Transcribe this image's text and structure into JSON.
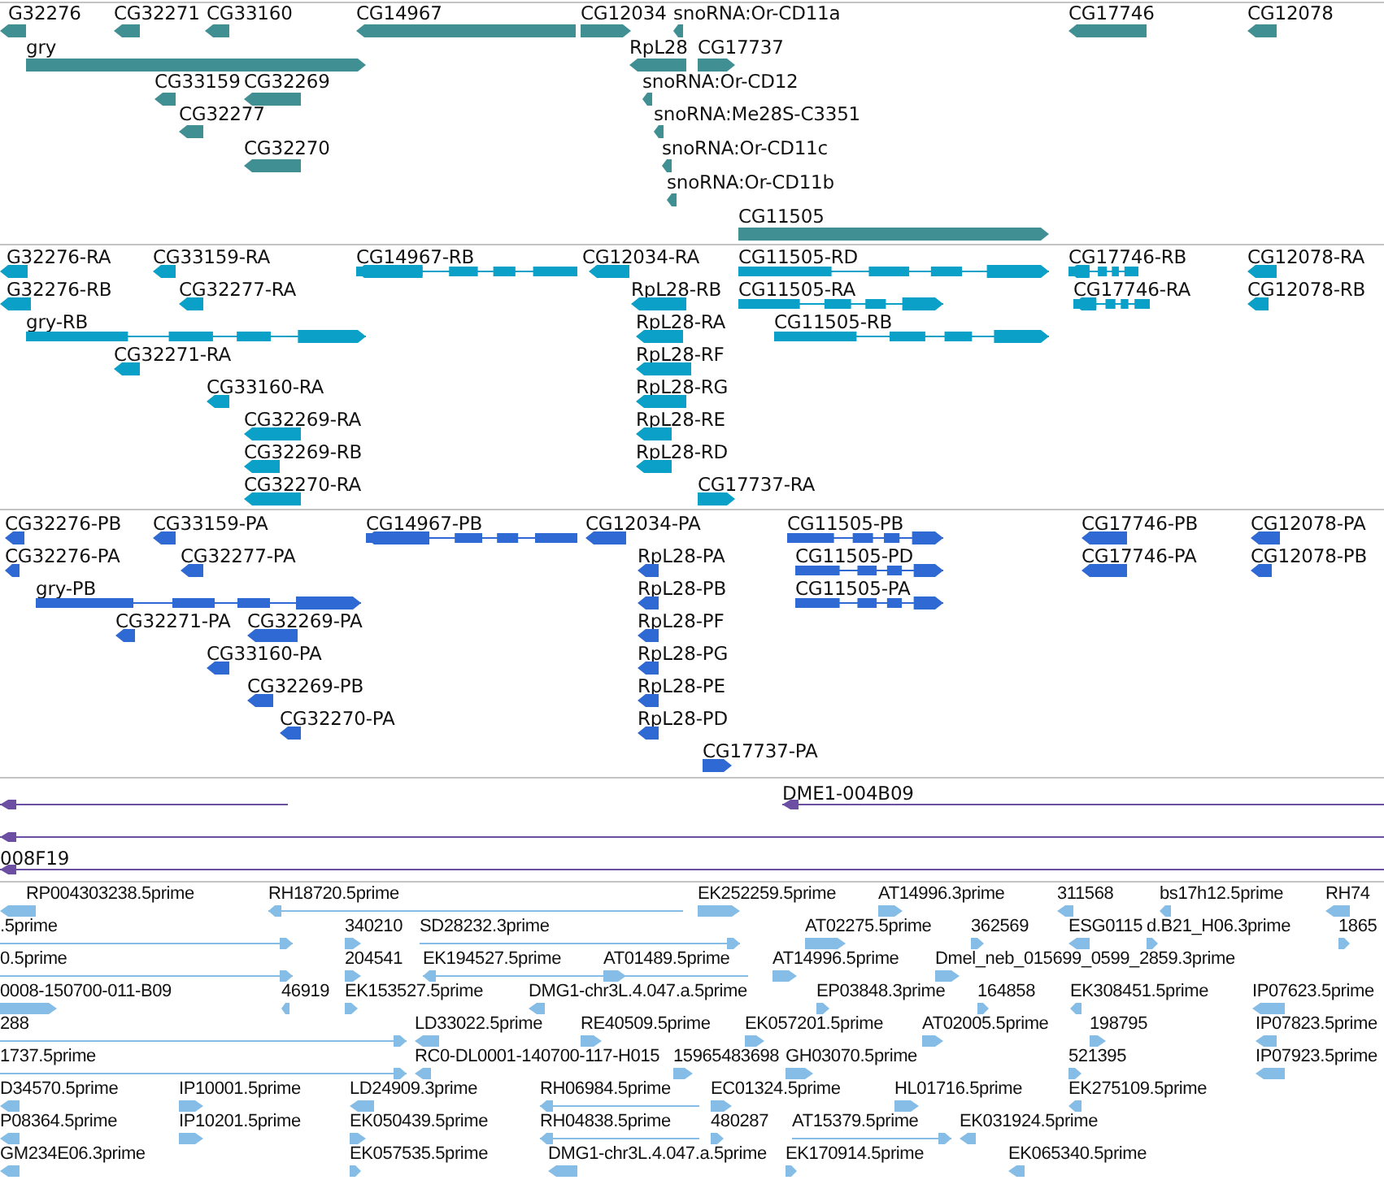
{
  "tracks": [
    {
      "kind": "gene",
      "lanes": [
        {
          "features": [
            {
              "label": "G32276",
              "reverse": true
            },
            {
              "label": "CG32271",
              "reverse": true
            },
            {
              "label": "CG33160",
              "reverse": true
            },
            {
              "label": "CG14967",
              "reverse": true
            },
            {
              "label": "CG12034",
              "reverse": false
            },
            {
              "label": "snoRNA:Or-CD11a",
              "reverse": true
            },
            {
              "label": "CG17746",
              "reverse": true
            },
            {
              "label": "CG12078",
              "reverse": true
            }
          ]
        },
        {
          "features": [
            {
              "label": "gry",
              "reverse": false
            },
            {
              "label": "RpL28",
              "reverse": true
            },
            {
              "label": "CG17737",
              "reverse": false
            }
          ]
        },
        {
          "features": [
            {
              "label": "CG33159",
              "reverse": true
            },
            {
              "label": "CG32269",
              "reverse": true
            },
            {
              "label": "snoRNA:Or-CD12",
              "reverse": true
            }
          ]
        },
        {
          "features": [
            {
              "label": "CG32277",
              "reverse": true
            },
            {
              "label": "snoRNA:Me28S-C3351",
              "reverse": true
            }
          ]
        },
        {
          "features": [
            {
              "label": "CG32270",
              "reverse": true
            },
            {
              "label": "snoRNA:Or-CD11c",
              "reverse": true
            }
          ]
        },
        {
          "features": [
            {
              "label": "snoRNA:Or-CD11b",
              "reverse": true
            }
          ]
        },
        {
          "features": [
            {
              "label": "CG11505",
              "reverse": false
            }
          ]
        }
      ]
    },
    {
      "kind": "mrna",
      "lanes": [
        {
          "features": [
            {
              "label": "G32276-RA",
              "reverse": true
            },
            {
              "label": "CG33159-RA",
              "reverse": true
            },
            {
              "label": "CG14967-RB",
              "reverse": true
            },
            {
              "label": "CG12034-RA",
              "reverse": true
            },
            {
              "label": "CG11505-RD",
              "reverse": false
            },
            {
              "label": "CG17746-RB",
              "reverse": true
            },
            {
              "label": "CG12078-RA",
              "reverse": true
            }
          ]
        },
        {
          "features": [
            {
              "label": "G32276-RB",
              "reverse": true
            },
            {
              "label": "CG32277-RA",
              "reverse": true
            },
            {
              "label": "RpL28-RB",
              "reverse": true
            },
            {
              "label": "CG11505-RA",
              "reverse": false
            },
            {
              "label": "CG17746-RA",
              "reverse": true
            },
            {
              "label": "CG12078-RB",
              "reverse": true
            }
          ]
        },
        {
          "features": [
            {
              "label": "gry-RB",
              "reverse": false
            },
            {
              "label": "RpL28-RA",
              "reverse": true
            },
            {
              "label": "CG11505-RB",
              "reverse": false
            }
          ]
        },
        {
          "features": [
            {
              "label": "CG32271-RA",
              "reverse": true
            },
            {
              "label": "RpL28-RF",
              "reverse": true
            }
          ]
        },
        {
          "features": [
            {
              "label": "CG33160-RA",
              "reverse": true
            },
            {
              "label": "RpL28-RG",
              "reverse": true
            }
          ]
        },
        {
          "features": [
            {
              "label": "CG32269-RA",
              "reverse": true
            },
            {
              "label": "RpL28-RE",
              "reverse": true
            }
          ]
        },
        {
          "features": [
            {
              "label": "CG32269-RB",
              "reverse": true
            },
            {
              "label": "RpL28-RD",
              "reverse": true
            }
          ]
        },
        {
          "features": [
            {
              "label": "CG32270-RA",
              "reverse": true
            },
            {
              "label": "CG17737-RA",
              "reverse": false
            }
          ]
        }
      ]
    },
    {
      "kind": "protein",
      "lanes": [
        {
          "features": [
            {
              "label": "CG32276-PB",
              "reverse": true
            },
            {
              "label": "CG33159-PA",
              "reverse": true
            },
            {
              "label": "CG14967-PB",
              "reverse": true
            },
            {
              "label": "CG12034-PA",
              "reverse": true
            },
            {
              "label": "CG11505-PB",
              "reverse": false
            },
            {
              "label": "CG17746-PB",
              "reverse": true
            },
            {
              "label": "CG12078-PA",
              "reverse": true
            }
          ]
        },
        {
          "features": [
            {
              "label": "CG32276-PA",
              "reverse": true
            },
            {
              "label": "CG32277-PA",
              "reverse": true
            },
            {
              "label": "RpL28-PA",
              "reverse": true
            },
            {
              "label": "CG11505-PD",
              "reverse": false
            },
            {
              "label": "CG17746-PA",
              "reverse": true
            },
            {
              "label": "CG12078-PB",
              "reverse": true
            }
          ]
        },
        {
          "features": [
            {
              "label": "gry-PB",
              "reverse": false
            },
            {
              "label": "RpL28-PB",
              "reverse": true
            },
            {
              "label": "CG11505-PA",
              "reverse": false
            }
          ]
        },
        {
          "features": [
            {
              "label": "CG32271-PA",
              "reverse": true
            },
            {
              "label": "CG32269-PA",
              "reverse": true
            },
            {
              "label": "RpL28-PF",
              "reverse": true
            }
          ]
        },
        {
          "features": [
            {
              "label": "CG33160-PA",
              "reverse": true
            },
            {
              "label": "RpL28-PG",
              "reverse": true
            }
          ]
        },
        {
          "features": [
            {
              "label": "CG32269-PB",
              "reverse": true
            },
            {
              "label": "RpL28-PE",
              "reverse": true
            }
          ]
        },
        {
          "features": [
            {
              "label": "CG32270-PA",
              "reverse": true
            },
            {
              "label": "RpL28-PD",
              "reverse": true
            }
          ]
        },
        {
          "features": [
            {
              "label": "CG17737-PA",
              "reverse": false
            }
          ]
        }
      ]
    },
    {
      "kind": "clone",
      "lanes": [
        {
          "features": [
            {
              "reverse": true
            },
            {
              "label": "DME1-004B09",
              "reverse": true
            }
          ]
        },
        {
          "features": [
            {
              "reverse": true
            }
          ]
        },
        {
          "features": [
            {
              "label": "008F19",
              "reverse": true
            }
          ]
        }
      ]
    },
    {
      "kind": "est",
      "lanes": [
        {
          "features": [
            {
              "label": "RP004303238.5prime",
              "reverse": true
            },
            {
              "label": "RH18720.5prime",
              "reverse": true
            },
            {
              "label": "EK252259.5prime",
              "reverse": false
            },
            {
              "label": "AT14996.3prime",
              "reverse": false
            },
            {
              "label": "311568",
              "reverse": true
            },
            {
              "label": "bs17h12.5prime",
              "reverse": true
            },
            {
              "label": "RH74",
              "reverse": true
            }
          ]
        },
        {
          "features": [
            {
              "label": ".5prime",
              "reverse": false
            },
            {
              "label": "340210",
              "reverse": false
            },
            {
              "label": "SD28232.3prime",
              "reverse": false
            },
            {
              "label": "AT02275.5prime",
              "reverse": false
            },
            {
              "label": "362569",
              "reverse": false
            },
            {
              "label": "ESG0115",
              "reverse": true
            },
            {
              "label": "d.B21_H06.3prime",
              "reverse": false
            },
            {
              "label": "1865",
              "reverse": false
            }
          ]
        },
        {
          "features": [
            {
              "label": "0.5prime",
              "reverse": false
            },
            {
              "label": "204541",
              "reverse": false
            },
            {
              "label": "EK194527.5prime",
              "reverse": true
            },
            {
              "label": "AT01489.5prime",
              "reverse": false
            },
            {
              "label": "AT14996.5prime",
              "reverse": false
            },
            {
              "label": "Dmel_neb_015699_0599_2859.3prime",
              "reverse": false
            }
          ]
        },
        {
          "features": [
            {
              "label": "0008-150700-011-B09",
              "reverse": false
            },
            {
              "label": "46919",
              "reverse": true
            },
            {
              "label": "EK153527.5prime",
              "reverse": false
            },
            {
              "label": "DMG1-chr3L.4.047.a.5prime",
              "reverse": true
            },
            {
              "label": "EP03848.3prime",
              "reverse": false
            },
            {
              "label": "164858",
              "reverse": false
            },
            {
              "label": "EK308451.5prime",
              "reverse": true
            },
            {
              "label": "IP07623.5prime",
              "reverse": true
            }
          ]
        },
        {
          "features": [
            {
              "label": "288",
              "reverse": false
            },
            {
              "label": "LD33022.5prime",
              "reverse": true
            },
            {
              "label": "RE40509.5prime",
              "reverse": false
            },
            {
              "label": "EK057201.5prime",
              "reverse": false
            },
            {
              "label": "AT02005.5prime",
              "reverse": false
            },
            {
              "label": "198795",
              "reverse": false
            },
            {
              "label": "IP07823.5prime",
              "reverse": true
            }
          ]
        },
        {
          "features": [
            {
              "label": "1737.5prime",
              "reverse": false
            },
            {
              "label": "RC0-DL0001-140700-117-H015",
              "reverse": true
            },
            {
              "label": "15965483698",
              "reverse": false
            },
            {
              "label": "GH03070.5prime",
              "reverse": false
            },
            {
              "label": "521395",
              "reverse": false
            },
            {
              "label": "IP07923.5prime",
              "reverse": true
            }
          ]
        },
        {
          "features": [
            {
              "label": "D34570.5prime",
              "reverse": true
            },
            {
              "label": "IP10001.5prime",
              "reverse": false
            },
            {
              "label": "LD24909.3prime",
              "reverse": true
            },
            {
              "label": "RH06984.5prime",
              "reverse": true
            },
            {
              "label": "EC01324.5prime",
              "reverse": false
            },
            {
              "label": "HL01716.5prime",
              "reverse": false
            },
            {
              "label": "EK275109.5prime",
              "reverse": true
            }
          ]
        },
        {
          "features": [
            {
              "label": "P08364.5prime",
              "reverse": true
            },
            {
              "label": "IP10201.5prime",
              "reverse": false
            },
            {
              "label": "EK050439.5prime",
              "reverse": false
            },
            {
              "label": "RH04838.5prime",
              "reverse": true
            },
            {
              "label": "480287",
              "reverse": false
            },
            {
              "label": "AT15379.5prime",
              "reverse": false
            },
            {
              "label": "EK031924.5prime",
              "reverse": true
            }
          ]
        },
        {
          "features": [
            {
              "label": "GM234E06.3prime",
              "reverse": true
            },
            {
              "label": "EK057535.5prime",
              "reverse": false
            },
            {
              "label": "DMG1-chr3L.4.047.a.5prime",
              "reverse": true
            },
            {
              "label": "EK170914.5prime",
              "reverse": false
            },
            {
              "label": "EK065340.5prime",
              "reverse": true
            }
          ]
        }
      ]
    }
  ]
}
